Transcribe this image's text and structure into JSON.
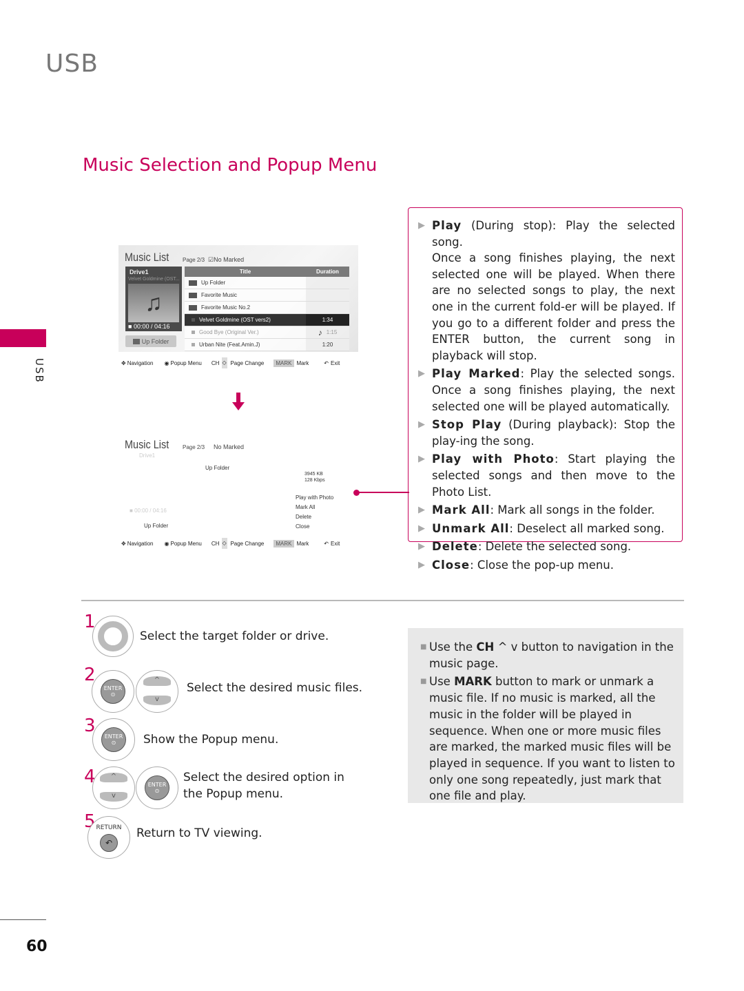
{
  "chapter": "USB",
  "side_label": "USB",
  "page_number": "60",
  "section_title": "Music Selection and Popup Menu",
  "colors": {
    "accent": "#c8005a",
    "gray_text": "#777777",
    "note_bg": "#e8e8e8"
  },
  "screen1": {
    "title": "Music List",
    "page": "Page 2/3",
    "marked": "No Marked",
    "drive": "Drive1",
    "now_playing": "Velvet Goldmine (OST...",
    "time": "00:00 / 04:16",
    "up_folder_button": "Up Folder",
    "table": {
      "headers": [
        "Title",
        "Duration"
      ],
      "rows": [
        {
          "title": "Up Folder",
          "duration": "",
          "type": "up-folder"
        },
        {
          "title": "Favorite Music",
          "duration": "",
          "type": "folder"
        },
        {
          "title": "Favorite Music No.2",
          "duration": "",
          "type": "folder"
        },
        {
          "title": "Velvet Goldmine (OST vers2)",
          "duration": "1:34",
          "type": "song-selected"
        },
        {
          "title": "Good Bye (Original Ver.)",
          "duration": "1:15",
          "type": "song-playing"
        },
        {
          "title": "Urban Nite (Feat.Amin.J)",
          "duration": "1:20",
          "type": "song"
        }
      ]
    }
  },
  "guide_bar": {
    "navigation": "Navigation",
    "popup_menu": "Popup Menu",
    "ch": "CH",
    "page_change": "Page Change",
    "mark_key": "MARK",
    "mark": "Mark",
    "exit": "Exit"
  },
  "screen2": {
    "title": "Music List",
    "page": "Page 2/3",
    "marked": "No Marked",
    "drive": "Drive1",
    "up_folder": "Up Folder",
    "size": "3945 KB",
    "bitrate": "128 Kbps",
    "time": "00:00 / 04:16",
    "up_folder_button": "Up Folder",
    "popup_menu": [
      "Play with Photo",
      "Mark All",
      "Delete",
      "Close"
    ]
  },
  "options": [
    {
      "name": "Play",
      "text": " (During stop): Play the selected song.",
      "extra": "Once a song finishes playing, the next selected one will be played. When there are no selected songs to play, the next one in the current fold-er will be played. If you go to a different folder and press the ENTER button, the current song in playback will stop."
    },
    {
      "name": "Play Marked",
      "text": ": Play the selected songs. Once a song finishes playing, the next selected one will be played automatically."
    },
    {
      "name": "Stop Play",
      "text": " (During playback): Stop the play-ing the song."
    },
    {
      "name": "Play with Photo",
      "text": ": Start playing the selected songs and then move to the Photo List."
    },
    {
      "name": "Mark All",
      "text": ": Mark all songs in the folder."
    },
    {
      "name": "Unmark All",
      "text": ": Deselect all marked song."
    },
    {
      "name": "Delete",
      "text": ": Delete the selected song."
    },
    {
      "name": "Close",
      "text": ": Close the pop-up menu."
    }
  ],
  "steps": [
    {
      "num": "1",
      "text": "Select the target folder or drive."
    },
    {
      "num": "2",
      "text": "Select the desired music files."
    },
    {
      "num": "3",
      "text": "Show the Popup menu."
    },
    {
      "num": "4",
      "text": "Select the desired  option in the Popup menu."
    },
    {
      "num": "5",
      "text": "Return to TV viewing."
    }
  ],
  "remote": {
    "enter": "ENTER",
    "return": "RETURN"
  },
  "notes": [
    {
      "pre": "Use the ",
      "key": "CH",
      "post": "  ^ v  button to navigation in the music page."
    },
    {
      "pre": "Use ",
      "key": "MARK",
      "post": " button to mark or unmark a music file. If no music is marked, all the music in the folder will be played in sequence. When one or more music files are marked, the marked music files will be played in sequence. If you want to listen to only one song repeatedly, just mark that one file and play."
    }
  ]
}
